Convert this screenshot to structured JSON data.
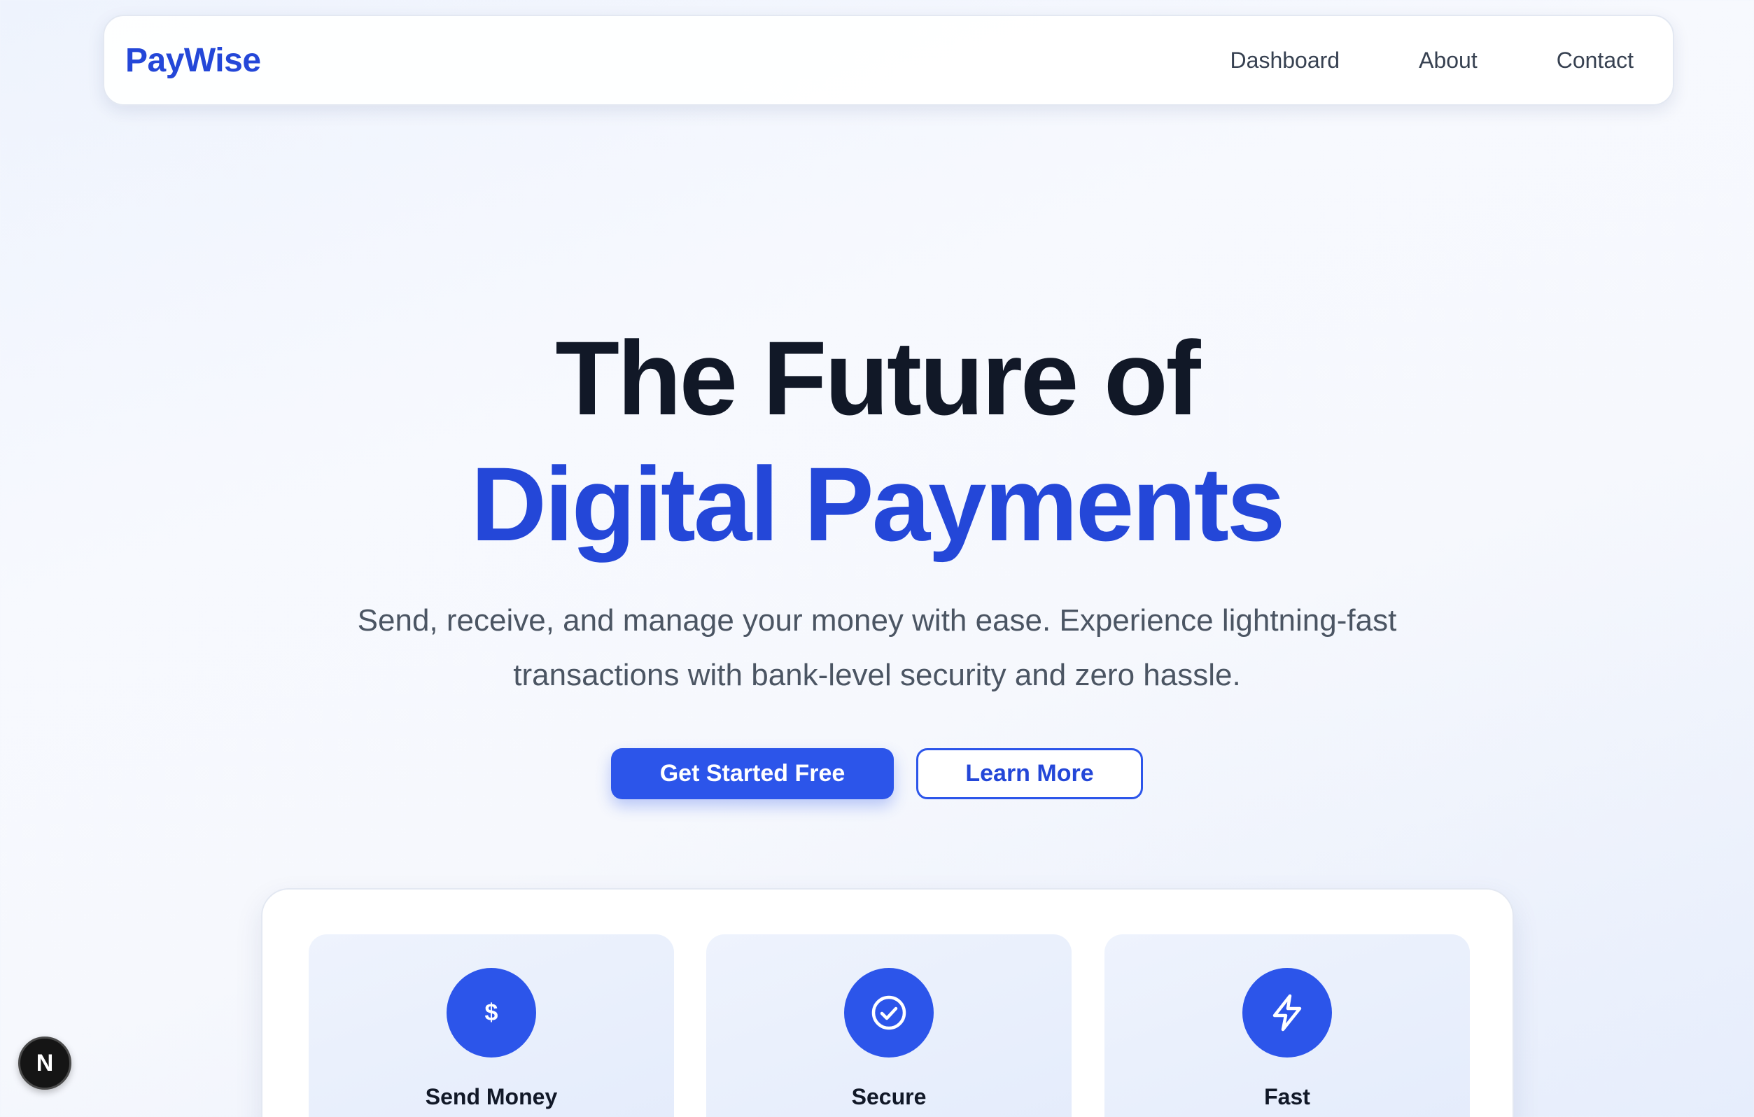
{
  "nav": {
    "logo": "PayWise",
    "links": [
      "Dashboard",
      "About",
      "Contact"
    ]
  },
  "hero": {
    "title_line1": "The Future of",
    "title_line2": "Digital Payments",
    "subtitle": "Send, receive, and manage your money with ease. Experience lightning-fast transactions with bank-level security and zero hassle.",
    "primary_cta": "Get Started Free",
    "secondary_cta": "Learn More"
  },
  "features": [
    {
      "title": "Send Money",
      "icon": "dollar-icon"
    },
    {
      "title": "Secure",
      "icon": "check-circle-icon"
    },
    {
      "title": "Fast",
      "icon": "lightning-icon"
    }
  ],
  "dev_badge": {
    "label": "N",
    "icon": "nextjs-icon"
  },
  "colors": {
    "brand": "#2447d8",
    "primary_button": "#2c55ea",
    "heading": "#111827",
    "body_text": "#4b5563"
  }
}
